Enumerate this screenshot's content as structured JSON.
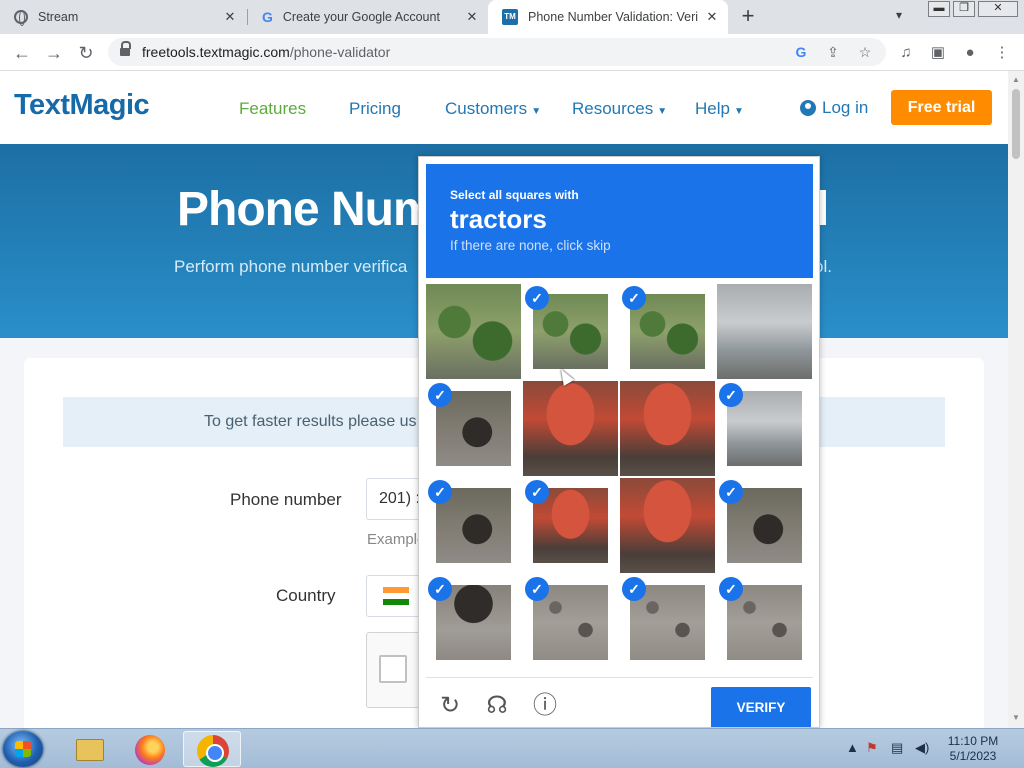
{
  "browser": {
    "tabs": [
      {
        "title": "Stream",
        "icon": "globe-icon"
      },
      {
        "title": "Create your Google Account",
        "icon": "google-icon"
      },
      {
        "title": "Phone Number Validation: Verify",
        "icon": "textmagic-icon"
      }
    ],
    "favicon_tm": "TM",
    "favicon_g": "G",
    "new_tab": "+",
    "tab_close": "✕",
    "url_host": "freetools.textmagic.com",
    "url_path": "/phone-validator"
  },
  "site": {
    "logo": "TextMagic",
    "nav": [
      {
        "label": "Features"
      },
      {
        "label": "Pricing"
      },
      {
        "label": "Customers"
      },
      {
        "label": "Resources"
      },
      {
        "label": "Help"
      }
    ],
    "login": "Log in",
    "free_trial": "Free trial"
  },
  "hero": {
    "title": "Phone Num",
    "title_tail": "l",
    "subtitle": "Perform phone number verifica",
    "subtitle_tail": "ol."
  },
  "form": {
    "banner": "To get faster results please us",
    "phone_label": "Phone number",
    "phone_value": "201) :",
    "example": "Example",
    "country_label": "Country"
  },
  "captcha": {
    "instruction": "Select all squares with",
    "target": "tractors",
    "hint": "If there are none, click skip",
    "verify": "VERIFY",
    "check": "✓",
    "tiles": [
      {
        "selected": false,
        "kind": "bush"
      },
      {
        "selected": true,
        "kind": "bush"
      },
      {
        "selected": true,
        "kind": "bush"
      },
      {
        "selected": false,
        "kind": "car"
      },
      {
        "selected": true,
        "kind": "wheel"
      },
      {
        "selected": false,
        "kind": "tractor"
      },
      {
        "selected": false,
        "kind": "tractor"
      },
      {
        "selected": true,
        "kind": "car"
      },
      {
        "selected": true,
        "kind": "wheel"
      },
      {
        "selected": true,
        "kind": "tractor"
      },
      {
        "selected": false,
        "kind": "tractor"
      },
      {
        "selected": true,
        "kind": "wheel"
      },
      {
        "selected": true,
        "kind": "gravel-wheel"
      },
      {
        "selected": true,
        "kind": "gravel"
      },
      {
        "selected": true,
        "kind": "gravel"
      },
      {
        "selected": true,
        "kind": "gravel"
      }
    ]
  },
  "taskbar": {
    "time": "11:10 PM",
    "date": "5/1/2023"
  },
  "colors": {
    "accent": "#1a73e8",
    "brand": "#176aa8",
    "cta": "#ff8c00",
    "nav_active": "#5cab3c"
  }
}
